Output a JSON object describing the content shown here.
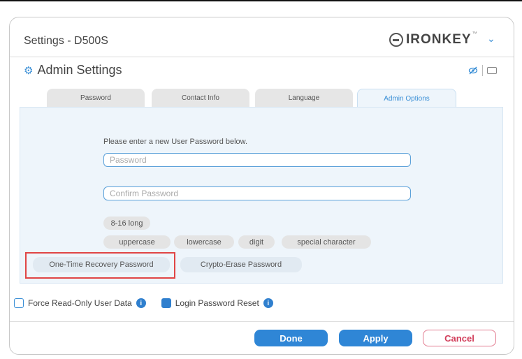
{
  "window": {
    "title": "Settings - D500S"
  },
  "brand": {
    "name": "IRONKEY",
    "tm": "™",
    "logo_icon": "ironkey-logo-icon",
    "menu_icon": "chevron-down-icon"
  },
  "header": {
    "title": "Admin Settings",
    "icon": "gear-icon",
    "visibility_icon": "eye-slash-icon",
    "keyboard_icon": "keyboard-icon"
  },
  "tabs": [
    {
      "label": "Password",
      "active": false
    },
    {
      "label": "Contact Info",
      "active": false
    },
    {
      "label": "Language",
      "active": false
    },
    {
      "label": "Admin Options",
      "active": true
    }
  ],
  "form": {
    "prompt": "Please enter a new User Password below.",
    "password_placeholder": "Password",
    "confirm_placeholder": "Confirm Password",
    "rules": [
      "8-16 long",
      "uppercase",
      "lowercase",
      "digit",
      "special character"
    ]
  },
  "actions": {
    "recovery": "One-Time Recovery Password",
    "crypto_erase": "Crypto-Erase Password"
  },
  "options": {
    "force_readonly": {
      "label": "Force Read-Only User Data",
      "checked": false
    },
    "login_reset": {
      "label": "Login Password Reset",
      "checked": true
    },
    "info_glyph": "i"
  },
  "footer": {
    "done": "Done",
    "apply": "Apply",
    "cancel": "Cancel"
  },
  "colors": {
    "accent": "#2f86d6",
    "highlight": "#e04545",
    "cancel": "#d23d5a"
  }
}
